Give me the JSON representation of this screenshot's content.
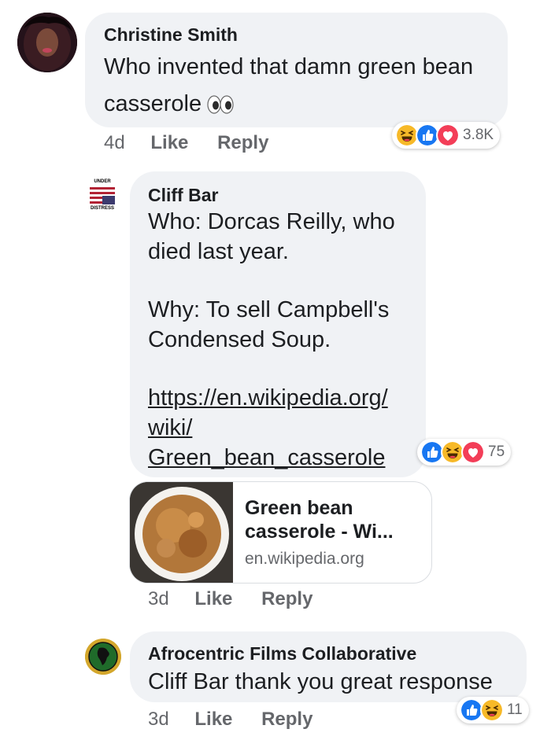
{
  "comments": [
    {
      "author": "Christine Smith",
      "lines": [
        "Who invented that damn green bean",
        "casserole"
      ],
      "emoji_name": "eyes-emoji",
      "time": "4d",
      "like_label": "Like",
      "reply_label": "Reply",
      "reaction_count": "3.8K",
      "reaction_icons": [
        "haha-icon",
        "like-icon",
        "love-icon"
      ]
    },
    {
      "author": "Cliff Bar",
      "avatar_text_top": "UNDER",
      "avatar_text_bottom": "DISTRESS",
      "lines": [
        "Who:  Dorcas Reilly, who",
        "died last year.",
        "Why:  To sell Campbell's",
        "Condensed Soup."
      ],
      "link_lines": [
        "https://en.wikipedia.org/",
        "wiki/",
        "Green_bean_casserole"
      ],
      "reaction_count": "75",
      "reaction_icons": [
        "like-icon",
        "haha-icon",
        "love-icon"
      ],
      "preview": {
        "title_lines": [
          "Green bean",
          "casserole - Wi..."
        ],
        "domain": "en.wikipedia.org"
      },
      "time": "3d",
      "like_label": "Like",
      "reply_label": "Reply"
    },
    {
      "author": "Afrocentric Films Collaborative",
      "lines": [
        "Cliff Bar thank you great response"
      ],
      "reaction_count": "11",
      "reaction_icons": [
        "like-icon",
        "haha-icon"
      ],
      "time": "3d",
      "like_label": "Like",
      "reply_label": "Reply"
    }
  ],
  "colors": {
    "bubble": "#f0f2f5",
    "meta": "#65676b",
    "like_blue": "#1877f2",
    "love_red": "#f33e58",
    "haha_yellow": "#f7b928"
  }
}
